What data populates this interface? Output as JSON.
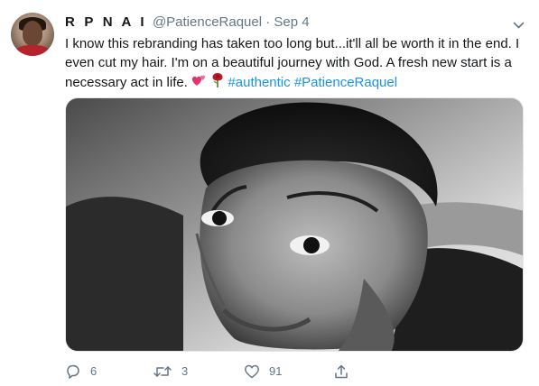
{
  "tweet": {
    "author_name": "R P N A I",
    "handle": "@PatienceRaquel",
    "separator": "·",
    "date": "Sep 4",
    "text_part1": "I know this rebranding has taken too long but...it'll all be worth it in the end. I even cut my hair. I'm on a beautiful journey with God. A fresh new start is a necessary act in life.",
    "emojis": [
      "two-hearts",
      "rose"
    ],
    "hashtags": [
      "#authentic",
      "#PatienceRaquel"
    ],
    "media": {
      "kind": "grayscale selfie photo"
    },
    "actions": {
      "replies": "6",
      "retweets": "3",
      "likes": "91"
    }
  },
  "colors": {
    "text": "#14171a",
    "muted": "#657786",
    "link": "#1b95e0",
    "heart_emoji": "#e5336f",
    "rose_emoji": "#c0182a"
  }
}
